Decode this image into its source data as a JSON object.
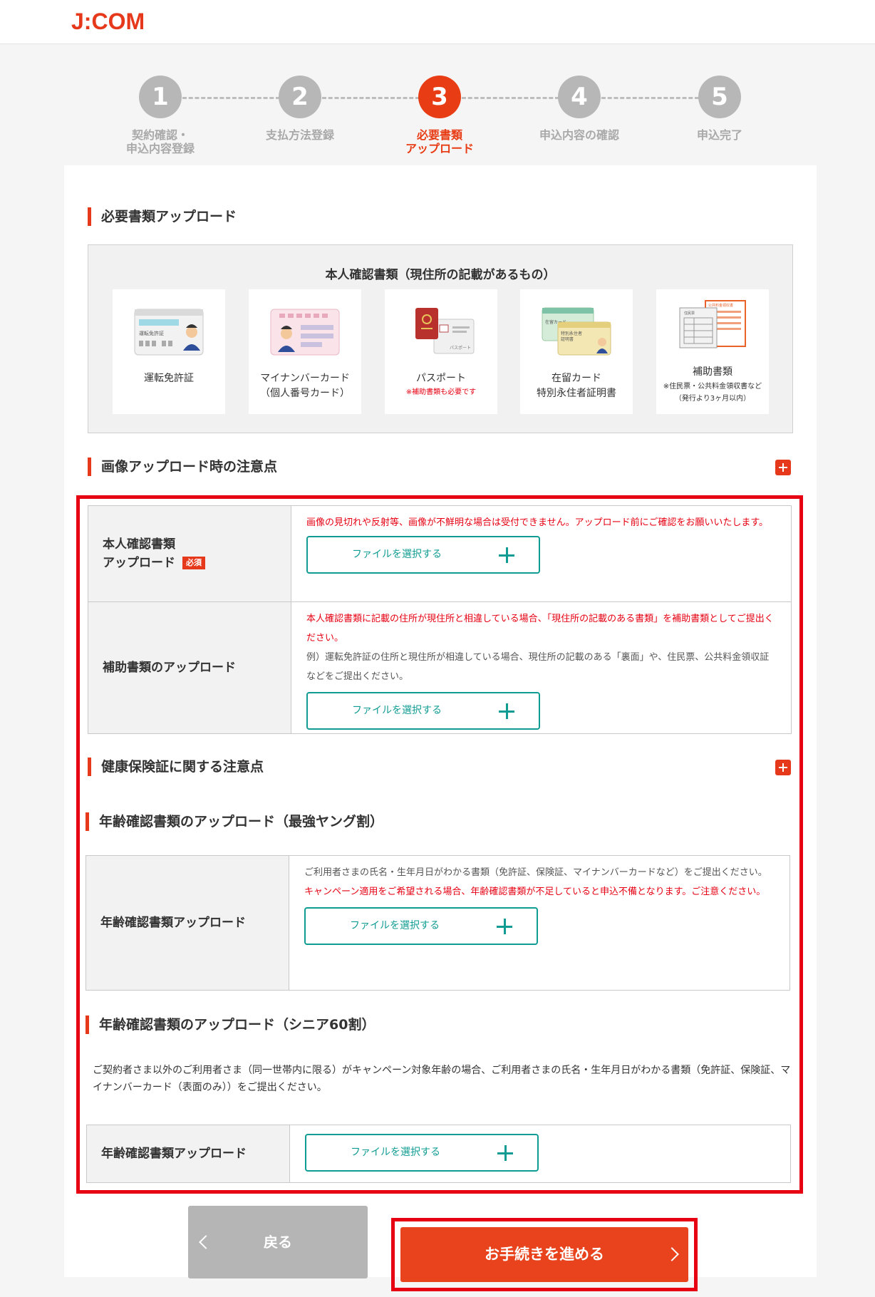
{
  "header": {
    "logo": "J:COM"
  },
  "steps": [
    {
      "num": "1",
      "label": "契約確認・\n申込内容登録",
      "active": false
    },
    {
      "num": "2",
      "label": "支払方法登録",
      "active": false
    },
    {
      "num": "3",
      "label": "必要書類\nアップロード",
      "active": true
    },
    {
      "num": "4",
      "label": "申込内容の確認",
      "active": false
    },
    {
      "num": "5",
      "label": "申込完了",
      "active": false
    }
  ],
  "section_upload": {
    "title": "必要書類アップロード"
  },
  "id_docs": {
    "title": "本人確認書類（現住所の記載があるもの）",
    "items": [
      {
        "name": "運転免許証",
        "note": ""
      },
      {
        "name": "マイナンバーカード\n（個人番号カード）",
        "note": ""
      },
      {
        "name": "パスポート",
        "note": "※補助書類も必要です"
      },
      {
        "name": "在留カード\n特別永住者証明書",
        "note": ""
      },
      {
        "name": "補助書類",
        "note": "※住民票・公共料金領収書など\n（発行より3ヶ月以内）"
      }
    ],
    "illus": {
      "license": "運転免許証",
      "passport": "パスポート",
      "residence": "在留カード",
      "residence2": "特別永住者\n証明書",
      "aux_a": "公共料金領収書",
      "aux_b": "住民票"
    }
  },
  "section_notes": {
    "title": "画像アップロード時の注意点"
  },
  "upload_table": {
    "row1": {
      "label": "本人確認書類\nアップロード",
      "required": "必須",
      "note": "画像の見切れや反射等、画像が不鮮明な場合は受付できません。アップロード前にご確認をお願いいたします。",
      "button": "ファイルを選択する"
    },
    "row2": {
      "label": "補助書類のアップロード",
      "note_red": "本人確認書類に記載の住所が現住所と相違している場合、「現住所の記載のある書類」を補助書類としてご提出ください。",
      "note_gray": "例）運転免許証の住所と現住所が相違している場合、現住所の記載のある「裏面」や、住民票、公共料金領収証などをご提出ください。",
      "button": "ファイルを選択する"
    }
  },
  "section_insurance": {
    "title": "健康保険証に関する注意点"
  },
  "section_young": {
    "title": "年齢確認書類のアップロード（最強ヤング割）",
    "label": "年齢確認書類アップロード",
    "note_gray": "ご利用者さまの氏名・生年月日がわかる書類（免許証、保険証、マイナンバーカードなど）をご提出ください。",
    "note_red": "キャンペーン適用をご希望される場合、年齢確認書類が不足していると申込不備となります。ご注意ください。",
    "button": "ファイルを選択する"
  },
  "section_senior": {
    "title": "年齢確認書類のアップロード（シニア60割）",
    "desc": "ご契約者さま以外のご利用者さま（同一世帯内に限る）がキャンペーン対象年齢の場合、ご利用者さまの氏名・生年月日がわかる書類（免許証、保険証、マイナンバーカード（表面のみ））をご提出ください。",
    "label": "年齢確認書類アップロード",
    "button": "ファイルを選択する"
  },
  "footer": {
    "back": "戻る",
    "next": "お手続きを進める"
  },
  "colors": {
    "brand": "#e6381a",
    "teal": "#119c93",
    "highlight": "#e60012"
  }
}
